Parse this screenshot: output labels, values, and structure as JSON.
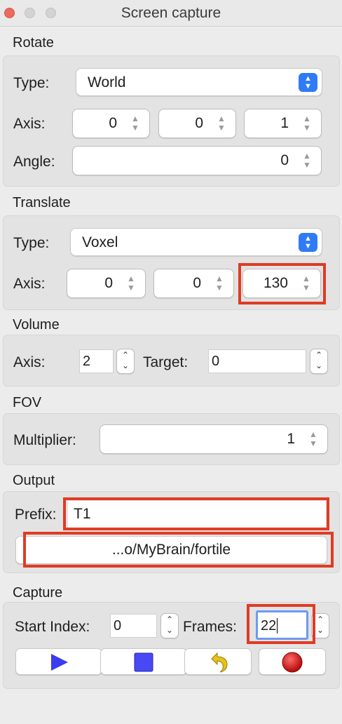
{
  "window": {
    "title": "Screen capture"
  },
  "rotate": {
    "section_label": "Rotate",
    "type_label": "Type:",
    "type_value": "World",
    "axis_label": "Axis:",
    "axis_values": [
      "0",
      "0",
      "1"
    ],
    "angle_label": "Angle:",
    "angle_value": "0"
  },
  "translate": {
    "section_label": "Translate",
    "type_label": "Type:",
    "type_value": "Voxel",
    "axis_label": "Axis:",
    "axis_values": [
      "0",
      "0",
      "130"
    ]
  },
  "volume": {
    "section_label": "Volume",
    "axis_label": "Axis:",
    "axis_value": "2",
    "target_label": "Target:",
    "target_value": "0"
  },
  "fov": {
    "section_label": "FOV",
    "multiplier_label": "Multiplier:",
    "multiplier_value": "1"
  },
  "output": {
    "section_label": "Output",
    "prefix_label": "Prefix:",
    "prefix_value": "T1",
    "folder_button_label": "...o/MyBrain/fortile"
  },
  "capture": {
    "section_label": "Capture",
    "start_index_label": "Start Index:",
    "start_index_value": "0",
    "frames_label": "Frames:",
    "frames_value": "22",
    "buttons": [
      "play-icon",
      "stop-icon",
      "undo-icon",
      "record-icon"
    ]
  },
  "colors": {
    "accent": "#2f7bf5",
    "highlight": "#e03b24",
    "play": "#3b3bf0",
    "stop": "#4848f5",
    "undo": "#e6c21a",
    "record": "#d01818"
  }
}
